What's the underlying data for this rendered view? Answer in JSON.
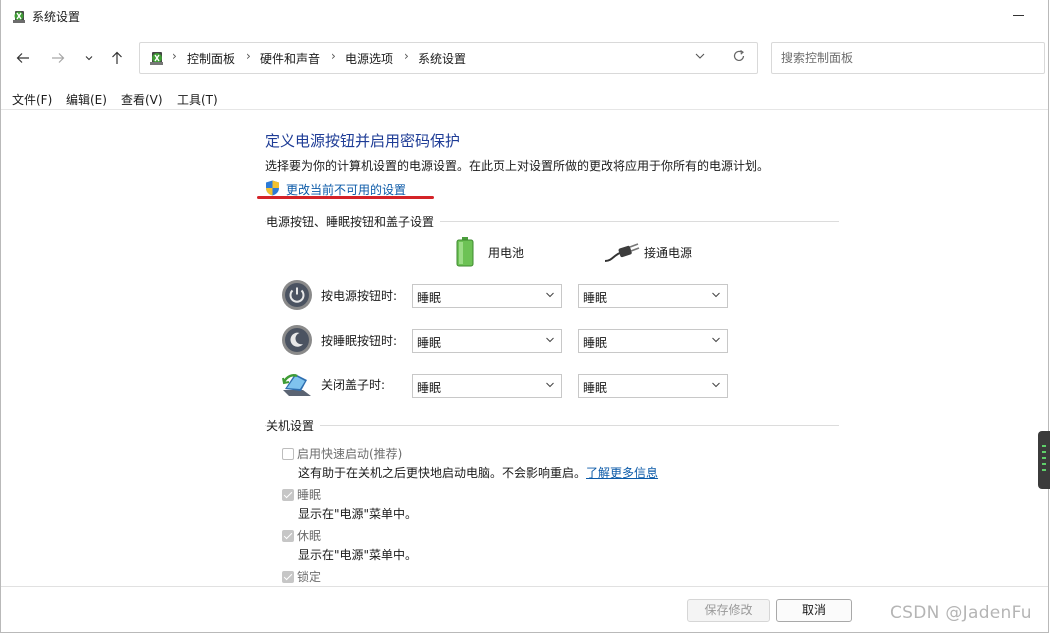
{
  "window": {
    "title": "系统设置"
  },
  "nav": {
    "breadcrumb": [
      "控制面板",
      "硬件和声音",
      "电源选项",
      "系统设置"
    ],
    "search_placeholder": "搜索控制面板"
  },
  "menu": [
    "文件(F)",
    "编辑(E)",
    "查看(V)",
    "工具(T)"
  ],
  "content": {
    "title": "定义电源按钮并启用密码保护",
    "description": "选择要为你的计算机设置的电源设置。在此页上对设置所做的更改将应用于你所有的电源计划。",
    "change_link": "更改当前不可用的设置",
    "buttons_section": {
      "label": "电源按钮、睡眠按钮和盖子设置",
      "columns": [
        "用电池",
        "接通电源"
      ],
      "rows": [
        {
          "label": "按电源按钮时:",
          "battery": "睡眠",
          "plugged": "睡眠"
        },
        {
          "label": "按睡眠按钮时:",
          "battery": "睡眠",
          "plugged": "睡眠"
        },
        {
          "label": "关闭盖子时:",
          "battery": "睡眠",
          "plugged": "睡眠"
        }
      ]
    },
    "shutdown_section": {
      "label": "关机设置",
      "items": [
        {
          "label": "启用快速启动(推荐)",
          "checked": false,
          "desc": "这有助于在关机之后更快地启动电脑。不会影响重启。",
          "link": "了解更多信息"
        },
        {
          "label": "睡眠",
          "checked": true,
          "desc": "显示在\"电源\"菜单中。"
        },
        {
          "label": "休眠",
          "checked": true,
          "desc": "显示在\"电源\"菜单中。"
        },
        {
          "label": "锁定",
          "checked": true
        }
      ]
    }
  },
  "footer": {
    "save_label": "保存修改",
    "cancel_label": "取消"
  },
  "watermark": "CSDN @JadenFu",
  "colors": {
    "title": "#1e3c96",
    "link": "#0b5aa8",
    "highlight": "#d42328"
  }
}
